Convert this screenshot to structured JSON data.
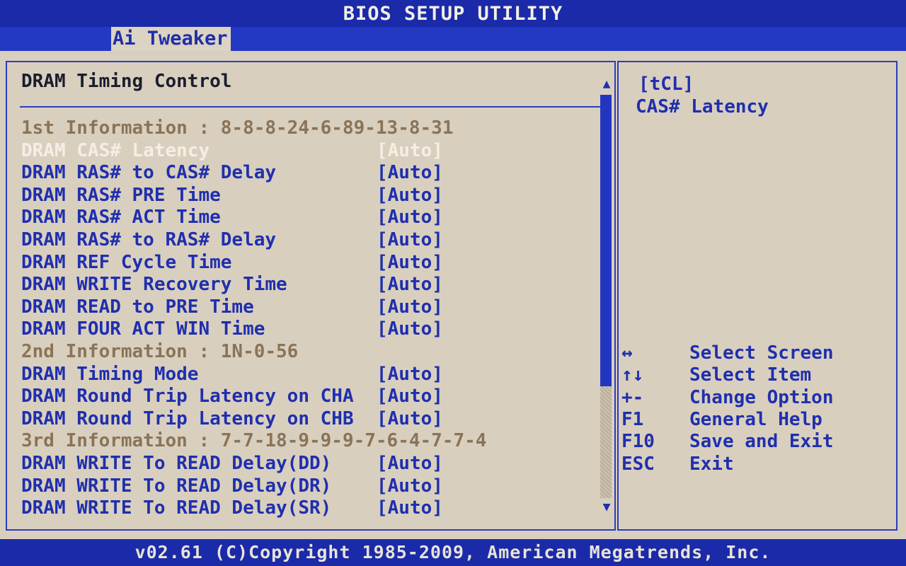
{
  "window": {
    "title": "BIOS SETUP UTILITY"
  },
  "tabs": [
    {
      "label": "Ai Tweaker",
      "active": true
    }
  ],
  "main": {
    "heading": "DRAM Timing Control",
    "rows": [
      {
        "label": "1st Information : 8-8-8-24-6-89-13-8-31",
        "value": "",
        "type": "info"
      },
      {
        "label": "DRAM CAS# Latency",
        "value": "[Auto]",
        "type": "selected"
      },
      {
        "label": "DRAM RAS# to CAS# Delay",
        "value": "[Auto]",
        "type": "item"
      },
      {
        "label": "DRAM RAS# PRE Time",
        "value": "[Auto]",
        "type": "item"
      },
      {
        "label": "DRAM RAS# ACT Time",
        "value": "[Auto]",
        "type": "item"
      },
      {
        "label": "DRAM RAS# to RAS# Delay",
        "value": "[Auto]",
        "type": "item"
      },
      {
        "label": "DRAM REF Cycle Time",
        "value": "[Auto]",
        "type": "item"
      },
      {
        "label": "DRAM WRITE Recovery Time",
        "value": "[Auto]",
        "type": "item"
      },
      {
        "label": "DRAM READ to PRE Time",
        "value": "[Auto]",
        "type": "item"
      },
      {
        "label": "DRAM FOUR ACT WIN Time",
        "value": "[Auto]",
        "type": "item"
      },
      {
        "label": "2nd Information : 1N-0-56",
        "value": "",
        "type": "info"
      },
      {
        "label": "DRAM Timing Mode",
        "value": "[Auto]",
        "type": "item"
      },
      {
        "label": "DRAM Round Trip Latency on CHA",
        "value": "[Auto]",
        "type": "item"
      },
      {
        "label": "DRAM Round Trip Latency on CHB",
        "value": "[Auto]",
        "type": "item"
      },
      {
        "label": "3rd Information : 7-7-18-9-9-9-7-6-4-7-7-4",
        "value": "",
        "type": "info"
      },
      {
        "label": "DRAM WRITE To READ Delay(DD)",
        "value": "[Auto]",
        "type": "item"
      },
      {
        "label": "DRAM WRITE To READ Delay(DR)",
        "value": "[Auto]",
        "type": "item"
      },
      {
        "label": "DRAM WRITE To READ Delay(SR)",
        "value": "[Auto]",
        "type": "item"
      }
    ]
  },
  "help": {
    "title": "[tCL]",
    "description": "CAS# Latency",
    "keys": [
      {
        "key": "↔",
        "desc": "Select Screen"
      },
      {
        "key": "↑↓",
        "desc": "Select Item"
      },
      {
        "key": "+-",
        "desc": "Change Option"
      },
      {
        "key": "F1",
        "desc": "General Help"
      },
      {
        "key": "F10",
        "desc": "Save and Exit"
      },
      {
        "key": "ESC",
        "desc": "Exit"
      }
    ]
  },
  "footer": {
    "text": "v02.61 (C)Copyright 1985-2009, American Megatrends, Inc."
  },
  "scrollbar": {
    "up_icon": "▲",
    "down_icon": "▼"
  },
  "colors": {
    "background_blue": "#2236b8",
    "panel": "#d9cfbe",
    "item_text": "#1f2fae",
    "info_text": "#8a7458",
    "selected_text": "#f4efe4"
  }
}
